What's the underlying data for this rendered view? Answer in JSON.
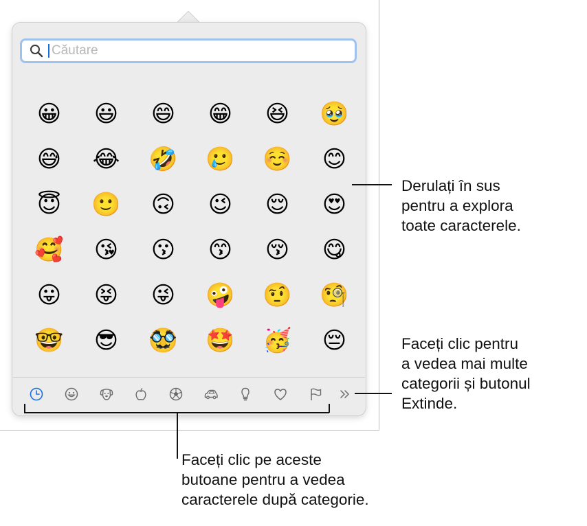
{
  "search": {
    "placeholder": "Căutare"
  },
  "emoji_grid": [
    "😀",
    "😃",
    "😄",
    "😁",
    "😆",
    "🥹",
    "😅",
    "😂",
    "🤣",
    "🥲",
    "☺️",
    "😊",
    "😇",
    "🙂",
    "🙃",
    "😉",
    "😌",
    "😍",
    "🥰",
    "😘",
    "😗",
    "😙",
    "😚",
    "😋",
    "😛",
    "😝",
    "😜",
    "🤪",
    "🤨",
    "🧐",
    "🤓",
    "😎",
    "🥸",
    "🤩",
    "🥳",
    "😔"
  ],
  "category_bar": {
    "items": [
      {
        "name": "tab-frequently-used",
        "icon": "clock-icon",
        "selected": true
      },
      {
        "name": "tab-smileys-people",
        "icon": "smiley-icon",
        "selected": false
      },
      {
        "name": "tab-animals-nature",
        "icon": "dog-icon",
        "selected": false
      },
      {
        "name": "tab-food-drink",
        "icon": "apple-icon",
        "selected": false
      },
      {
        "name": "tab-activity",
        "icon": "soccer-ball-icon",
        "selected": false
      },
      {
        "name": "tab-travel-places",
        "icon": "car-icon",
        "selected": false
      },
      {
        "name": "tab-objects",
        "icon": "lightbulb-icon",
        "selected": false
      },
      {
        "name": "tab-symbols",
        "icon": "heart-icon",
        "selected": false
      },
      {
        "name": "tab-flags",
        "icon": "flag-icon",
        "selected": false
      }
    ],
    "more_icon": "double-chevron-right-icon"
  },
  "colors": {
    "accent": "#1a6fe0",
    "icon": "#6b6b6b",
    "popover_bg": "#ececec",
    "search_focus_ring": "#9ec2ee"
  },
  "annotations": {
    "scroll": [
      "Derulați în sus",
      "pentru a explora",
      "toate caracterele."
    ],
    "more": [
      "Faceți clic pentru",
      "a vedea mai multe",
      "categorii și butonul",
      "Extinde."
    ],
    "categories": [
      "Faceți clic pe aceste",
      "butoane pentru a vedea",
      "caracterele după categorie."
    ]
  }
}
